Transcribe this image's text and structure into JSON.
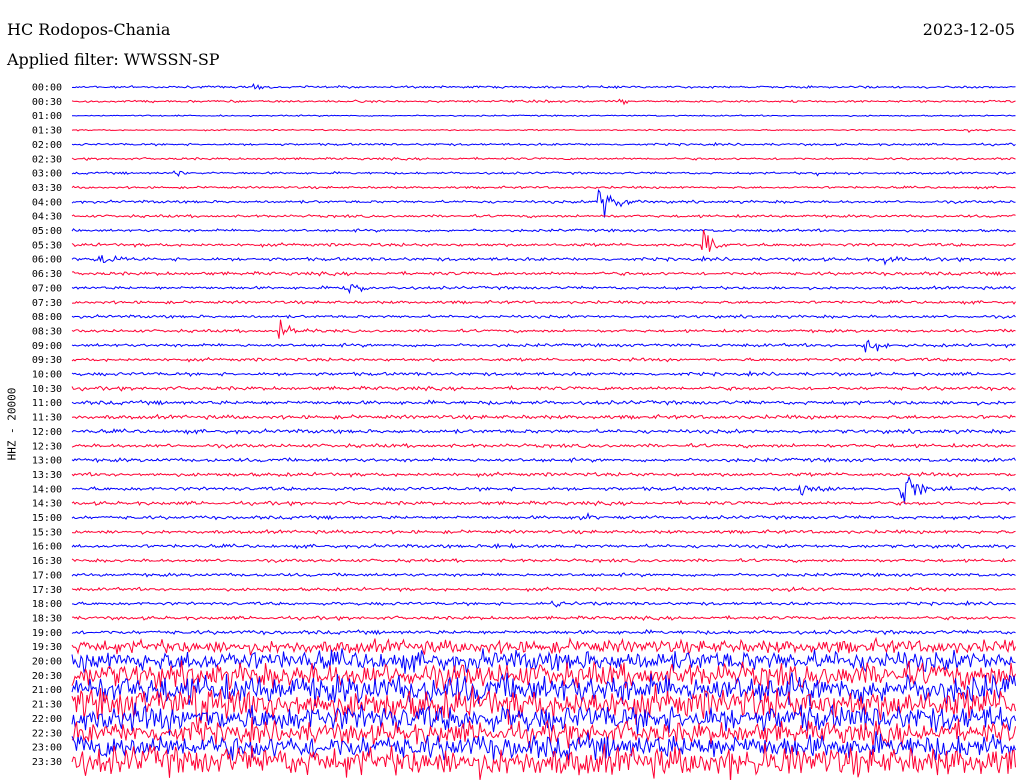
{
  "header": {
    "station": "HC Rodopos-Chania",
    "date": "2023-12-05",
    "filter_label": "Applied filter:",
    "filter_value": "WWSSN-SP"
  },
  "colors": {
    "even": "#0000ff",
    "odd": "#ff0033"
  },
  "chart_data": {
    "type": "line",
    "title": "HC Rodopos-Chania",
    "ylabel": "HHZ - 20000",
    "row_labels": [
      "00:00",
      "00:30",
      "01:00",
      "01:30",
      "02:00",
      "02:30",
      "03:00",
      "03:30",
      "04:00",
      "04:30",
      "05:00",
      "05:30",
      "06:00",
      "06:30",
      "07:00",
      "07:30",
      "08:00",
      "08:30",
      "09:00",
      "09:30",
      "10:00",
      "10:30",
      "11:00",
      "11:30",
      "12:00",
      "12:30",
      "13:00",
      "13:30",
      "14:00",
      "14:30",
      "15:00",
      "15:30",
      "16:00",
      "16:30",
      "17:00",
      "17:30",
      "18:00",
      "18:30",
      "19:00",
      "19:30",
      "20:00",
      "20:30",
      "21:00",
      "21:30",
      "22:00",
      "22:30",
      "23:00",
      "23:30"
    ],
    "row_noise": [
      1,
      1,
      0.6,
      0.6,
      1,
      1,
      1,
      1,
      1.2,
      1.2,
      1.2,
      1.4,
      1.5,
      1.5,
      1.3,
      1.3,
      1.3,
      1.3,
      1.4,
      1.4,
      1.5,
      1.6,
      1.7,
      1.7,
      1.7,
      1.6,
      1.6,
      1.6,
      1.6,
      1.6,
      1.5,
      1.5,
      1.5,
      1.4,
      1.4,
      1.4,
      1.4,
      1.5,
      1.7,
      6,
      9,
      11,
      13,
      14,
      12,
      10,
      11,
      13
    ],
    "events": [
      {
        "row": 0,
        "t": 0.19,
        "amp": 4
      },
      {
        "row": 1,
        "t": 0.58,
        "amp": 3
      },
      {
        "row": 3,
        "t": 0.95,
        "amp": 3
      },
      {
        "row": 6,
        "t": 0.11,
        "amp": 3
      },
      {
        "row": 6,
        "t": 0.79,
        "amp": 3
      },
      {
        "row": 8,
        "t": 0.56,
        "amp": 30
      },
      {
        "row": 11,
        "t": 0.67,
        "amp": 14
      },
      {
        "row": 12,
        "t": 0.03,
        "amp": 7
      },
      {
        "row": 12,
        "t": 0.86,
        "amp": 5
      },
      {
        "row": 14,
        "t": 0.29,
        "amp": 9
      },
      {
        "row": 17,
        "t": 0.22,
        "amp": 10
      },
      {
        "row": 18,
        "t": 0.84,
        "amp": 11
      },
      {
        "row": 28,
        "t": 0.77,
        "amp": 12
      },
      {
        "row": 28,
        "t": 0.88,
        "amp": 20
      },
      {
        "row": 30,
        "t": 0.54,
        "amp": 5
      },
      {
        "row": 32,
        "t": 0.45,
        "amp": 6
      },
      {
        "row": 35,
        "t": 0.76,
        "amp": 4
      },
      {
        "row": 36,
        "t": 0.51,
        "amp": 6
      },
      {
        "row": 43,
        "t": 0.13,
        "amp": 35
      },
      {
        "row": 47,
        "t": 0.7,
        "amp": 25
      }
    ]
  }
}
